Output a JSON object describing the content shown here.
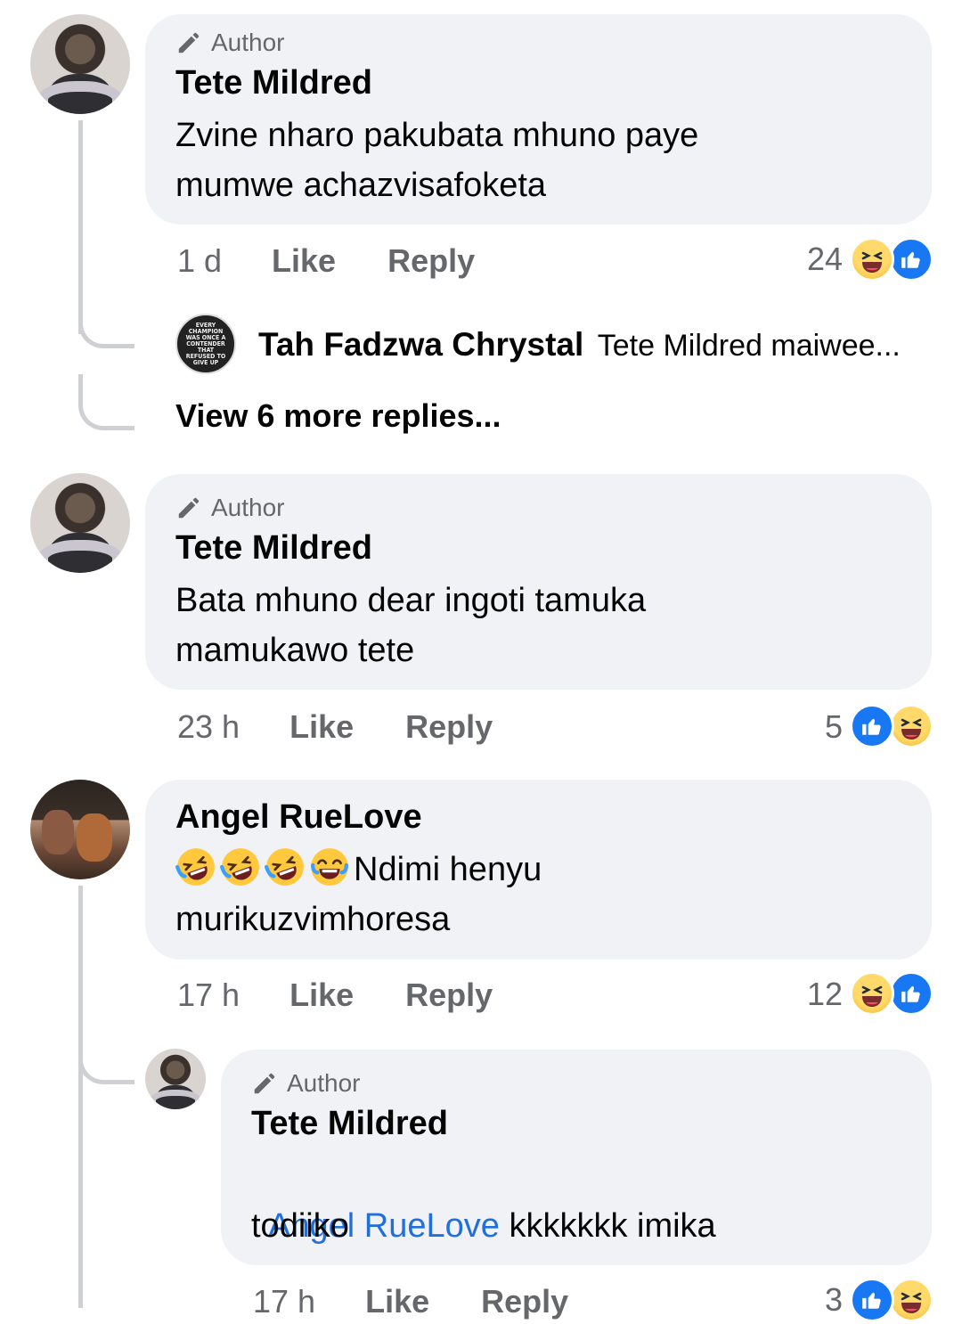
{
  "comments": [
    {
      "author_badge": "Author",
      "name": "Tete Mildred",
      "text_line1": "Zvine nharo pakubata mhuno paye",
      "text_line2": "mumwe achazvisafoketa",
      "time": "1 d",
      "like": "Like",
      "reply": "Reply",
      "reaction_count": "24",
      "reactions": [
        "haha",
        "like"
      ],
      "reply_preview": {
        "name": "Tah Fadzwa Chrystal",
        "text": "Tete Mildred  maiwee...",
        "avatar_text": "EVERY CHAMPION WAS ONCE A CONTENDER THAT REFUSED TO GIVE UP"
      },
      "view_more": "View 6 more replies..."
    },
    {
      "author_badge": "Author",
      "name": "Tete Mildred",
      "text_line1": "Bata mhuno dear ingoti tamuka",
      "text_line2": "mamukawo tete",
      "time": "23 h",
      "like": "Like",
      "reply": "Reply",
      "reaction_count": "5",
      "reactions": [
        "like",
        "haha"
      ]
    },
    {
      "name": "Angel RueLove",
      "text_line1": "Ndimi henyu",
      "text_line1_emojis": [
        "rolling-on-floor-laughing",
        "rolling-on-floor-laughing",
        "rolling-on-floor-laughing",
        "tears-of-joy"
      ],
      "text_line2": "murikuzvimhoresa",
      "time": "17 h",
      "like": "Like",
      "reply": "Reply",
      "reaction_count": "12",
      "reactions": [
        "haha",
        "like"
      ]
    },
    {
      "author_badge": "Author",
      "name": "Tete Mildred",
      "mention": "Angel RueLove",
      "text_line1": " kkkkkkk imika",
      "text_line2": "todiiko",
      "time": "17 h",
      "like": "Like",
      "reply": "Reply",
      "reaction_count": "3",
      "reactions": [
        "like",
        "haha"
      ]
    }
  ],
  "colors": {
    "bubble": "#f0f2f5",
    "meta_gray": "#65676b",
    "mention_blue": "#216fdb",
    "like_blue": "#1877f2",
    "haha_yellow": "#f7b125"
  }
}
